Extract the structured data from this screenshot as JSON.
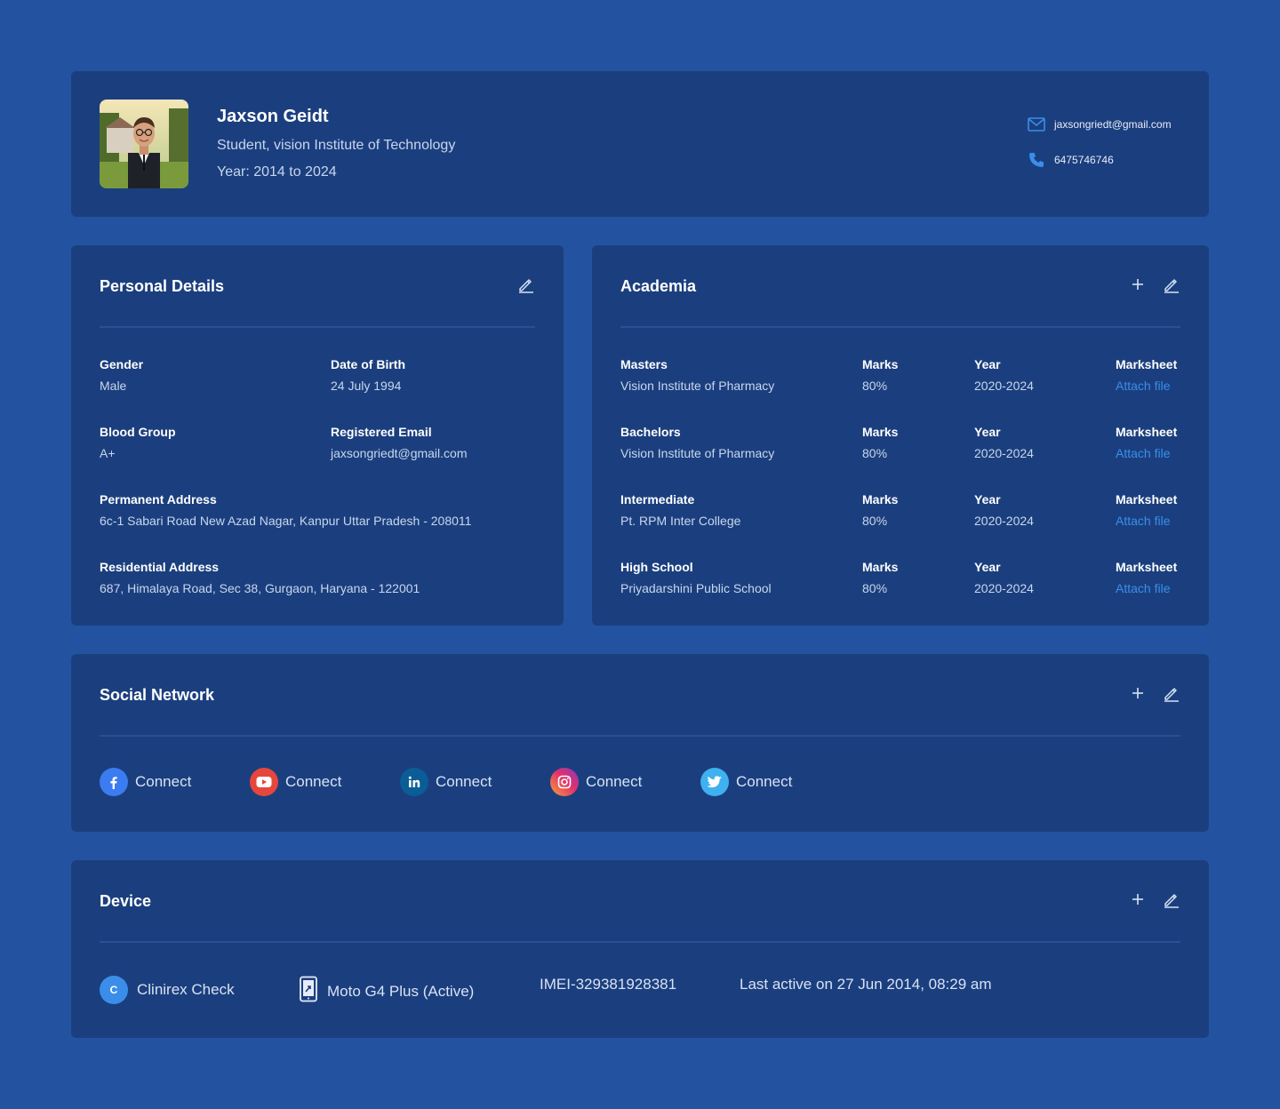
{
  "profile": {
    "name": "Jaxson Geidt",
    "subtitle": "Student, vision Institute of Technology",
    "year": "Year: 2014 to 2024",
    "email": "jaxsongriedt@gmail.com",
    "phone": "6475746746"
  },
  "personal": {
    "title": "Personal Details",
    "fields": [
      {
        "label": "Gender",
        "value": "Male"
      },
      {
        "label": "Date of Birth",
        "value": "24 July 1994"
      },
      {
        "label": "Blood Group",
        "value": "A+"
      },
      {
        "label": "Registered Email",
        "value": "jaxsongriedt@gmail.com"
      },
      {
        "label": "Permanent Address",
        "value": "6c-1 Sabari Road New Azad Nagar, Kanpur Uttar Pradesh - 208011"
      },
      {
        "label": "Residential Address",
        "value": "687, Himalaya Road, Sec 38, Gurgaon, Haryana - 122001"
      }
    ]
  },
  "academia": {
    "title": "Academia",
    "rows": [
      {
        "degree": "Masters",
        "school": "Vision Institute of Pharmacy",
        "marks_label": "Marks",
        "marks": "80%",
        "year_label": "Year",
        "year": "2020-2024",
        "sheet_label": "Marksheet",
        "sheet_action": "Attach file"
      },
      {
        "degree": "Bachelors",
        "school": "Vision Institute of Pharmacy",
        "marks_label": "Marks",
        "marks": "80%",
        "year_label": "Year",
        "year": "2020-2024",
        "sheet_label": "Marksheet",
        "sheet_action": "Attach file"
      },
      {
        "degree": "Intermediate",
        "school": "Pt. RPM Inter College",
        "marks_label": "Marks",
        "marks": "80%",
        "year_label": "Year",
        "year": "2020-2024",
        "sheet_label": "Marksheet",
        "sheet_action": "Attach file"
      },
      {
        "degree": "High School",
        "school": "Priyadarshini Public School",
        "marks_label": "Marks",
        "marks": "80%",
        "year_label": "Year",
        "year": "2020-2024",
        "sheet_label": "Marksheet",
        "sheet_action": "Attach file"
      }
    ]
  },
  "social": {
    "title": "Social Network",
    "items": [
      {
        "network": "facebook",
        "icon": "facebook-icon",
        "color": "#3b7cf0",
        "label": "Connect"
      },
      {
        "network": "youtube",
        "icon": "youtube-icon",
        "color": "#e5473c",
        "label": "Connect"
      },
      {
        "network": "linkedin",
        "icon": "linkedin-icon",
        "color": "#0a5d96",
        "label": "Connect"
      },
      {
        "network": "instagram",
        "icon": "instagram-icon",
        "color": "#d6409f",
        "label": "Connect"
      },
      {
        "network": "twitter",
        "icon": "twitter-icon",
        "color": "#3fb0f0",
        "label": "Connect"
      }
    ]
  },
  "device": {
    "title": "Device",
    "app_badge": "C",
    "app_name": "Clinirex Check",
    "device_name": "Moto G4 Plus (Active)",
    "imei": "IMEI-329381928381",
    "last_active": "Last active on 27 Jun 2014, 08:29 am"
  },
  "colors": {
    "background": "#2353a0",
    "card": "#1b3f7e",
    "accent": "#3a8eea"
  }
}
